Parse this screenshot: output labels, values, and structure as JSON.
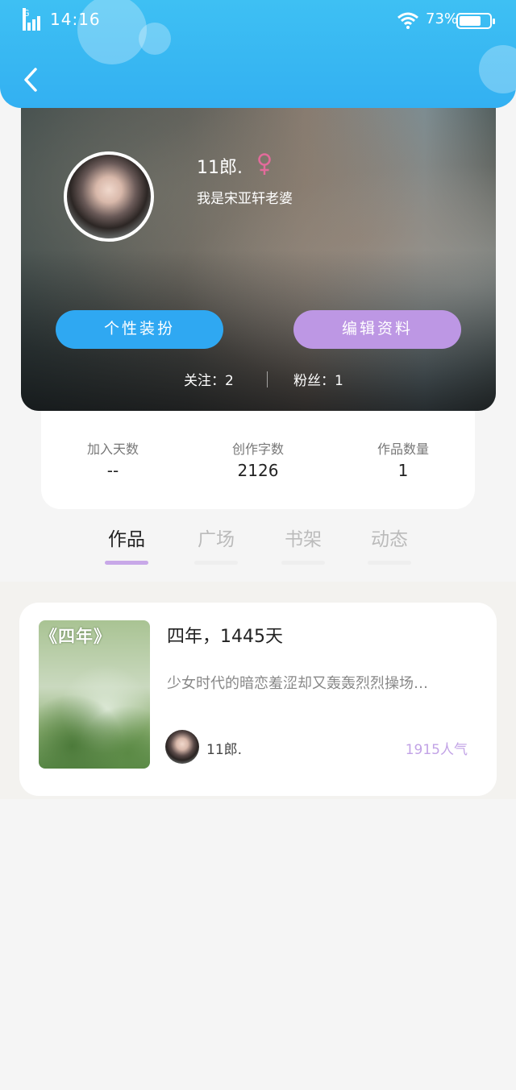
{
  "status_bar": {
    "time": "14:16",
    "battery": "73%",
    "battery_level": 0.73
  },
  "profile": {
    "name": "11郎.",
    "bio": "我是宋亚轩老婆",
    "gender_color": "#e26b9b",
    "dress_up_button": "个性装扮",
    "edit_profile_button": "编辑资料",
    "following": "关注：2",
    "followers": "粉丝：1"
  },
  "stats": [
    {
      "label": "加入天数",
      "value": "--"
    },
    {
      "label": "创作字数",
      "value": "2126"
    },
    {
      "label": "作品数量",
      "value": "1"
    }
  ],
  "tabs": [
    {
      "label": "作品",
      "active": true
    },
    {
      "label": "广场",
      "active": false
    },
    {
      "label": "书架",
      "active": false
    },
    {
      "label": "动态",
      "active": false
    }
  ],
  "work": {
    "cover_title": "《四年》",
    "title": "四年，1445天",
    "description": "少女时代的暗恋羞涩却又轰轰烈烈操场…",
    "author": "11郎.",
    "popularity": "1915人气"
  },
  "colors": {
    "header": "#3ab8f3",
    "dress_button": "#2fa8f2",
    "edit_button": "#bd97e4",
    "tab_accent": "#c8a8e8"
  }
}
